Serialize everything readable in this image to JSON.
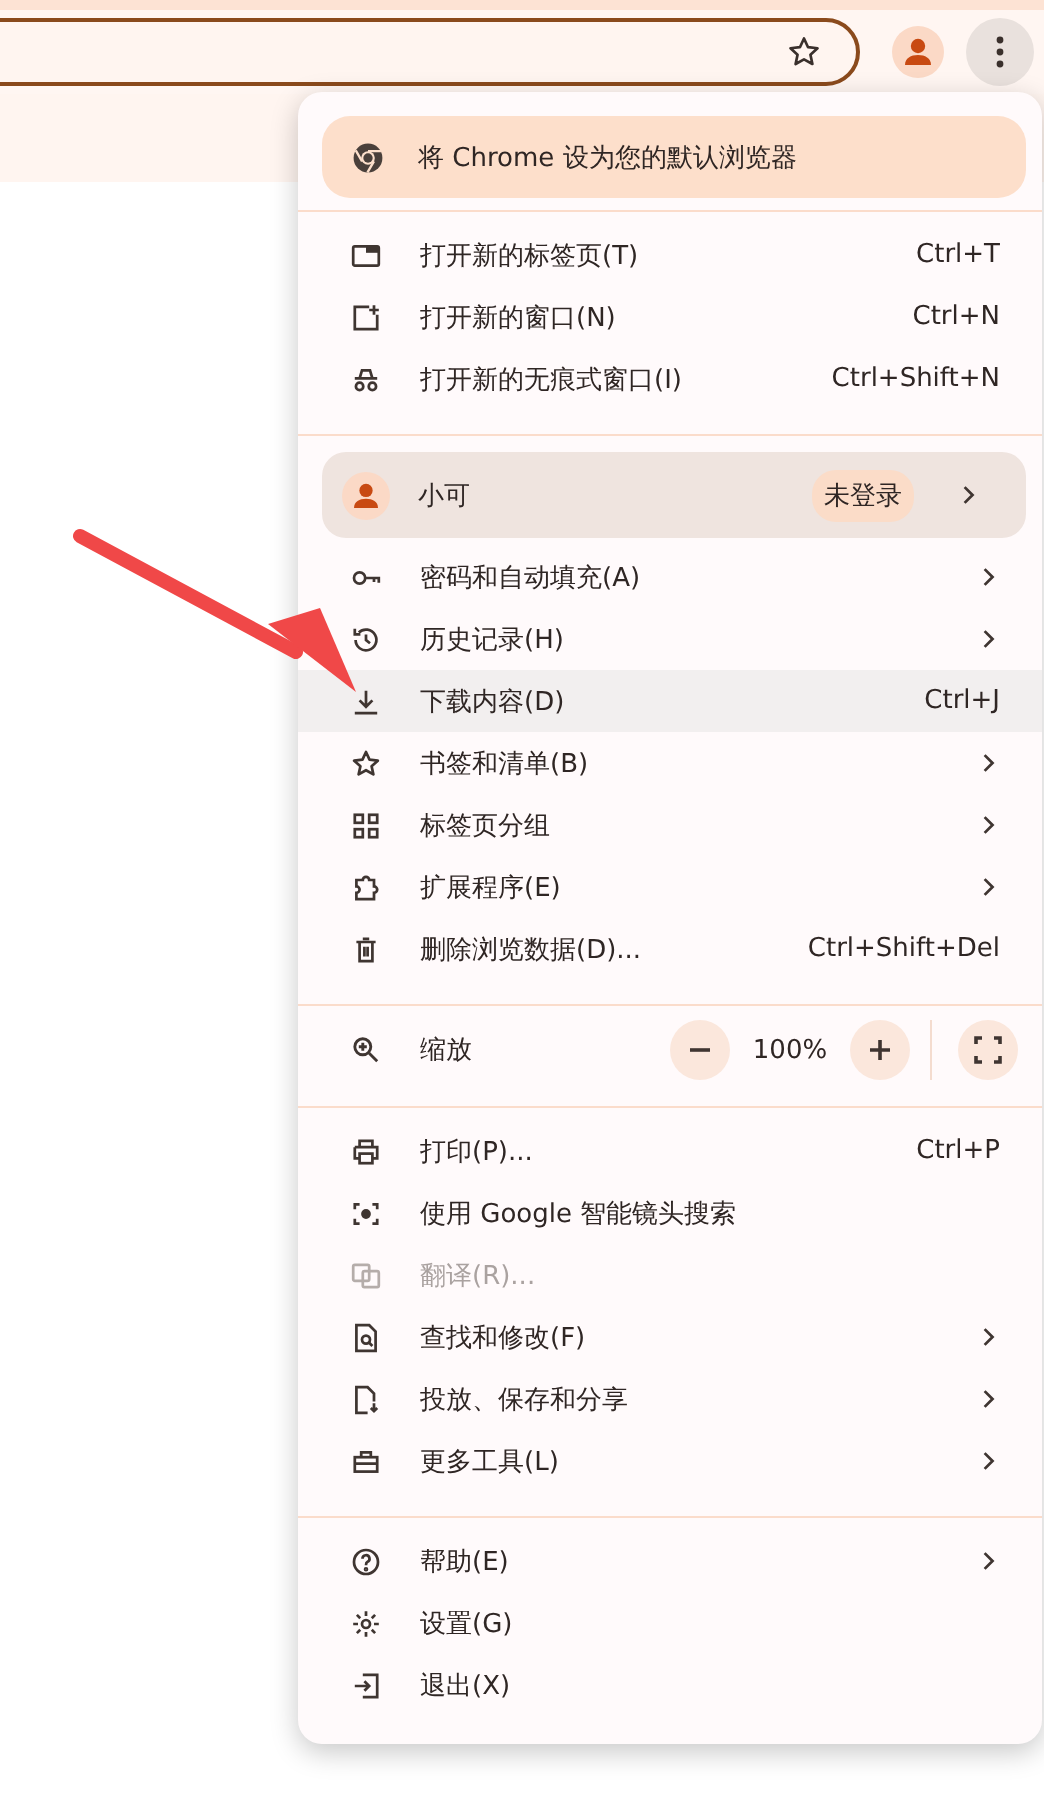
{
  "banner": {
    "label": "将 Chrome 设为您的默认浏览器"
  },
  "groups": [
    {
      "items": [
        {
          "kind": "item",
          "label": "打开新的标签页(T)",
          "shortcut": "Ctrl+T",
          "submenu": false,
          "disabled": false,
          "selected": false
        },
        {
          "kind": "item",
          "label": "打开新的窗口(N)",
          "shortcut": "Ctrl+N",
          "submenu": false,
          "disabled": false,
          "selected": false
        },
        {
          "kind": "item",
          "label": "打开新的无痕式窗口(I)",
          "shortcut": "Ctrl+Shift+N",
          "submenu": false,
          "disabled": false,
          "selected": false
        }
      ]
    },
    {
      "items": [
        {
          "kind": "profile",
          "name": "小可",
          "badge": "未登录",
          "submenu": true
        },
        {
          "kind": "item",
          "label": "密码和自动填充(A)",
          "submenu": true,
          "disabled": false,
          "selected": false
        },
        {
          "kind": "item",
          "label": "历史记录(H)",
          "submenu": true,
          "disabled": false,
          "selected": false
        },
        {
          "kind": "item",
          "label": "下载内容(D)",
          "shortcut": "Ctrl+J",
          "submenu": false,
          "disabled": false,
          "selected": true
        },
        {
          "kind": "item",
          "label": "书签和清单(B)",
          "submenu": true,
          "disabled": false,
          "selected": false
        },
        {
          "kind": "item",
          "label": "标签页分组",
          "submenu": true,
          "disabled": false,
          "selected": false
        },
        {
          "kind": "item",
          "label": "扩展程序(E)",
          "submenu": true,
          "disabled": false,
          "selected": false
        },
        {
          "kind": "item",
          "label": "删除浏览数据(D)...",
          "shortcut": "Ctrl+Shift+Del",
          "submenu": false,
          "disabled": false,
          "selected": false
        }
      ]
    },
    {
      "items": [
        {
          "kind": "zoom",
          "label": "缩放",
          "value": "100%"
        }
      ]
    },
    {
      "items": [
        {
          "kind": "item",
          "label": "打印(P)...",
          "shortcut": "Ctrl+P",
          "submenu": false,
          "disabled": false,
          "selected": false
        },
        {
          "kind": "item",
          "label": "使用 Google 智能镜头搜索",
          "submenu": false,
          "disabled": false,
          "selected": false
        },
        {
          "kind": "item",
          "label": "翻译(R)...",
          "submenu": false,
          "disabled": true,
          "selected": false
        },
        {
          "kind": "item",
          "label": "查找和修改(F)",
          "submenu": true,
          "disabled": false,
          "selected": false
        },
        {
          "kind": "item",
          "label": "投放、保存和分享",
          "submenu": true,
          "disabled": false,
          "selected": false
        },
        {
          "kind": "item",
          "label": "更多工具(L)",
          "submenu": true,
          "disabled": false,
          "selected": false
        }
      ]
    },
    {
      "items": [
        {
          "kind": "item",
          "label": "帮助(E)",
          "submenu": true,
          "disabled": false,
          "selected": false
        },
        {
          "kind": "item",
          "label": "设置(G)",
          "submenu": false,
          "disabled": false,
          "selected": false
        },
        {
          "kind": "item",
          "label": "退出(X)",
          "submenu": false,
          "disabled": false,
          "selected": false
        }
      ]
    }
  ]
}
